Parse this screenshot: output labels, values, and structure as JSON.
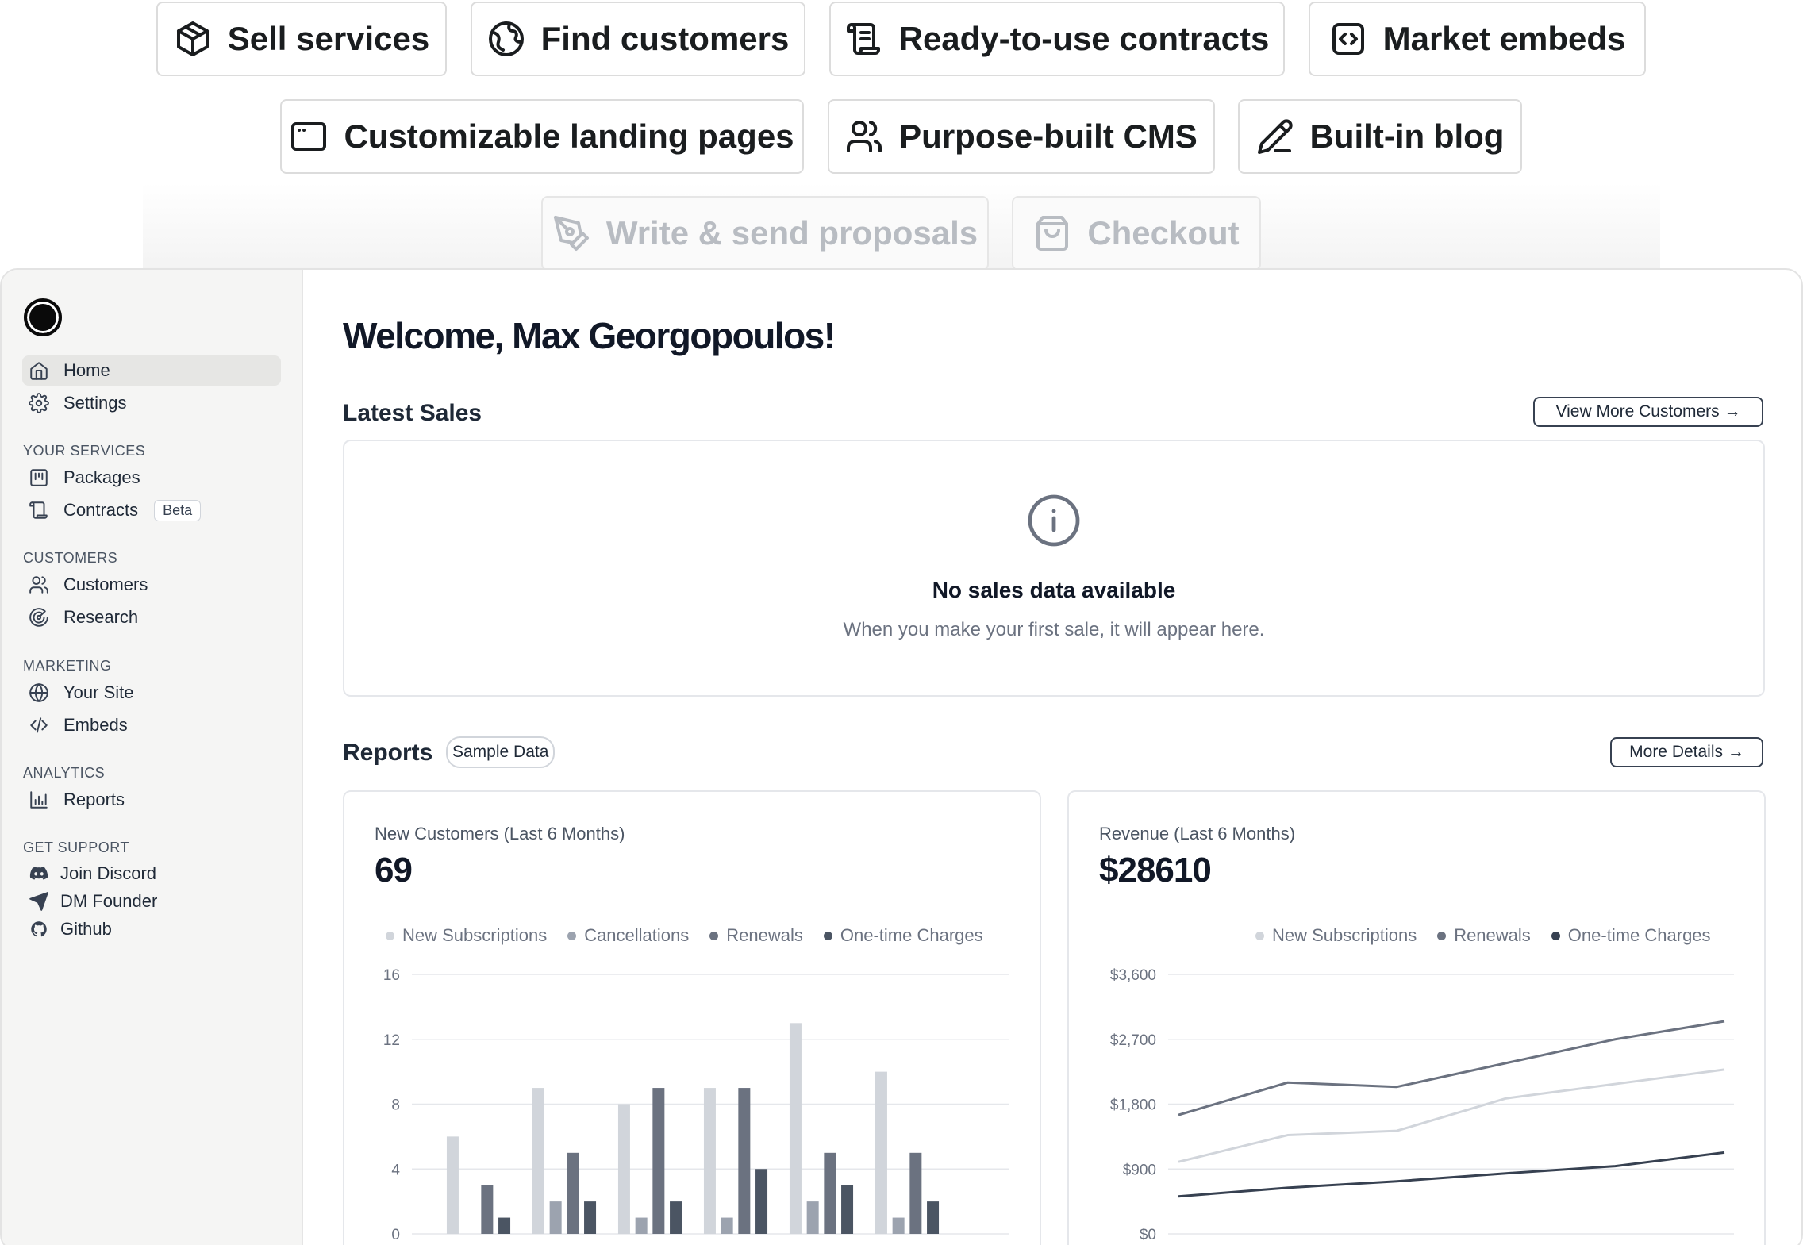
{
  "features": {
    "row1": [
      {
        "label": "Sell services",
        "icon": "package-icon"
      },
      {
        "label": "Find customers",
        "icon": "globe-icon"
      },
      {
        "label": "Ready-to-use contracts",
        "icon": "scroll-icon"
      },
      {
        "label": "Market embeds",
        "icon": "code-square-icon"
      }
    ],
    "row2": [
      {
        "label": "Customizable landing pages",
        "icon": "browser-window-icon"
      },
      {
        "label": "Purpose-built CMS",
        "icon": "users-icon"
      },
      {
        "label": "Built-in blog",
        "icon": "pencil-icon"
      }
    ],
    "row3": [
      {
        "label": "Write & send proposals",
        "icon": "pen-tool-icon"
      },
      {
        "label": "Checkout",
        "icon": "shopping-bag-icon"
      }
    ]
  },
  "sidebar": {
    "top_items": [
      {
        "label": "Home",
        "icon": "home-icon",
        "active": true
      },
      {
        "label": "Settings",
        "icon": "gear-icon"
      }
    ],
    "sections": [
      {
        "title": "YOUR SERVICES",
        "items": [
          {
            "label": "Packages",
            "icon": "package-list-icon"
          },
          {
            "label": "Contracts",
            "icon": "scroll-icon",
            "badge": "Beta"
          }
        ]
      },
      {
        "title": "CUSTOMERS",
        "items": [
          {
            "label": "Customers",
            "icon": "users-icon"
          },
          {
            "label": "Research",
            "icon": "radar-icon"
          }
        ]
      },
      {
        "title": "MARKETING",
        "items": [
          {
            "label": "Your Site",
            "icon": "globe-icon"
          },
          {
            "label": "Embeds",
            "icon": "code-icon"
          }
        ]
      },
      {
        "title": "ANALYTICS",
        "items": [
          {
            "label": "Reports",
            "icon": "bar-chart-icon"
          }
        ]
      },
      {
        "title": "GET SUPPORT",
        "items": [
          {
            "label": "Join Discord",
            "icon": "discord-icon"
          },
          {
            "label": "DM Founder",
            "icon": "send-icon"
          },
          {
            "label": "Github",
            "icon": "github-icon"
          }
        ]
      }
    ]
  },
  "main": {
    "welcome": "Welcome, Max Georgopoulos!",
    "latest_sales": {
      "title": "Latest Sales",
      "button": "View More Customers →",
      "empty_title": "No sales data available",
      "empty_subtitle": "When you make your first sale, it will appear here."
    },
    "reports": {
      "title": "Reports",
      "badge": "Sample Data",
      "button": "More Details →"
    }
  },
  "colors": {
    "new_subscriptions": "#d1d5db",
    "cancellations": "#9ca3af",
    "renewals": "#6b7280",
    "one_time_charges": "#4b5563",
    "line_one_time": "#374151"
  },
  "chart_data": [
    {
      "type": "bar",
      "label": "New Customers (Last 6 Months)",
      "total": "69",
      "ylim": [
        0,
        16
      ],
      "yticks": [
        "0",
        "4",
        "8",
        "12",
        "16"
      ],
      "legend": [
        "New Subscriptions",
        "Cancellations",
        "Renewals",
        "One-time Charges"
      ],
      "series": [
        {
          "name": "New Subscriptions",
          "values": [
            6,
            9,
            8,
            9,
            13,
            10
          ]
        },
        {
          "name": "Cancellations",
          "values": [
            0,
            2,
            1,
            1,
            2,
            1
          ]
        },
        {
          "name": "Renewals",
          "values": [
            3,
            5,
            9,
            9,
            5,
            5
          ]
        },
        {
          "name": "One-time Charges",
          "values": [
            1,
            2,
            2,
            4,
            3,
            2
          ]
        }
      ]
    },
    {
      "type": "line",
      "label": "Revenue (Last 6 Months)",
      "total": "$28610",
      "ylim": [
        0,
        3600
      ],
      "yticks": [
        "$0",
        "$900",
        "$1,800",
        "$2,700",
        "$3,600"
      ],
      "legend": [
        "New Subscriptions",
        "Renewals",
        "One-time Charges"
      ],
      "series": [
        {
          "name": "New Subscriptions",
          "values": [
            1000,
            1370,
            1430,
            1880,
            2080,
            2280
          ]
        },
        {
          "name": "Renewals",
          "values": [
            1650,
            2100,
            2040,
            2370,
            2700,
            2950
          ]
        },
        {
          "name": "One-time Charges",
          "values": [
            520,
            640,
            730,
            840,
            940,
            1130
          ]
        }
      ]
    }
  ]
}
